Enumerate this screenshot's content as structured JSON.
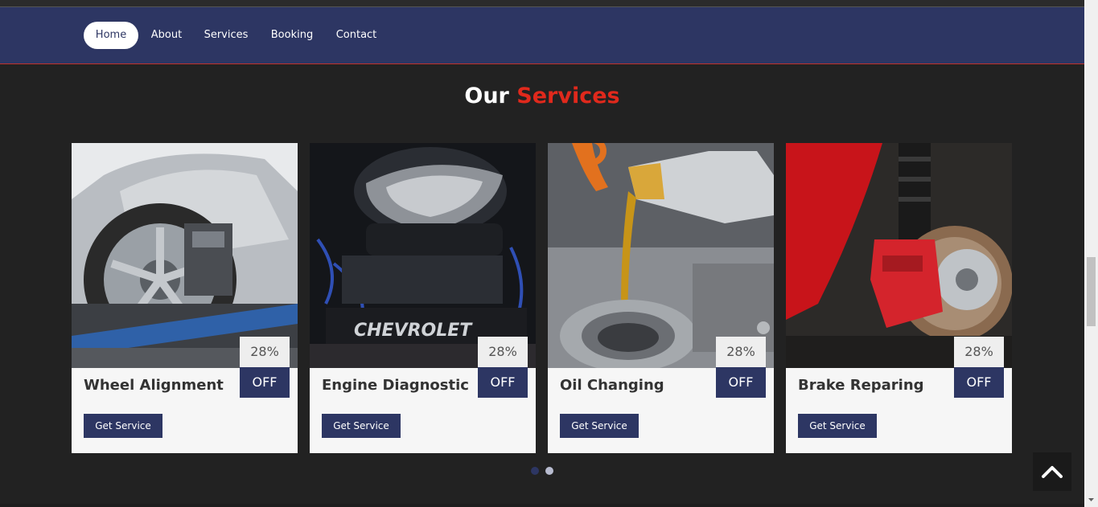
{
  "nav": {
    "items": [
      {
        "label": "Home",
        "active": true
      },
      {
        "label": "About",
        "active": false
      },
      {
        "label": "Services",
        "active": false
      },
      {
        "label": "Booking",
        "active": false
      },
      {
        "label": "Contact",
        "active": false
      }
    ]
  },
  "section": {
    "title_plain": "Our",
    "title_accent": "Services"
  },
  "services": [
    {
      "title": "Wheel Alignment",
      "discount": "28%",
      "off_label": "OFF",
      "button": "Get Service",
      "image": "car-wheel-alignment"
    },
    {
      "title": "Engine Diagnostic",
      "discount": "28%",
      "off_label": "OFF",
      "button": "Get Service",
      "image": "chevrolet-engine"
    },
    {
      "title": "Oil Changing",
      "discount": "28%",
      "off_label": "OFF",
      "button": "Get Service",
      "image": "oil-pouring"
    },
    {
      "title": "Brake Reparing",
      "discount": "28%",
      "off_label": "OFF",
      "button": "Get Service",
      "image": "brake-caliper"
    }
  ],
  "carousel": {
    "dots": 2,
    "active_dot": 1
  },
  "engine_badge": "CHEVROLET",
  "colors": {
    "navy": "#2d3663",
    "accent": "#e0291c",
    "background": "#222222",
    "card": "#f6f6f6"
  },
  "icons": {
    "scroll_top": "chevron-up-icon"
  }
}
